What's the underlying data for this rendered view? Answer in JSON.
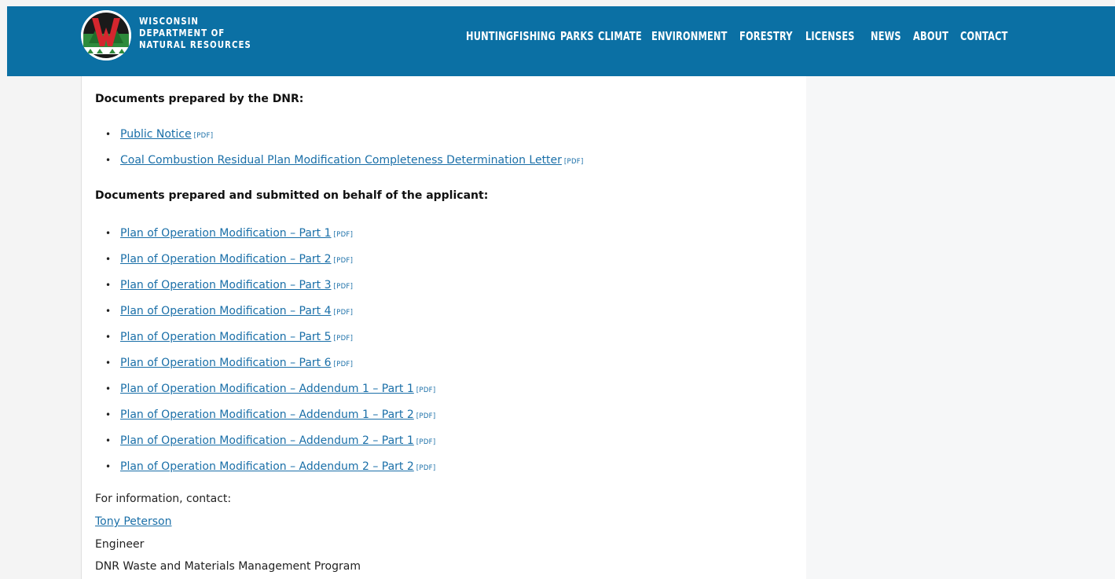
{
  "header": {
    "logo_lines": [
      "WISCONSIN",
      "DEPARTMENT OF",
      "NATURAL RESOURCES"
    ],
    "brand_color": "#0b70a4",
    "logo_icon": "dnr-w-logo-icon",
    "nav": [
      "HUNTING",
      "FISHING",
      "PARKS",
      "CLIMATE",
      "ENVIRONMENT",
      "FORESTRY",
      "LICENSES",
      "NEWS",
      "ABOUT",
      "CONTACT"
    ]
  },
  "main": {
    "dnr_heading": "Documents prepared by the DNR:",
    "dnr_docs": [
      {
        "label": "Public Notice",
        "tag": "[PDF]"
      },
      {
        "label": "Coal Combustion Residual Plan Modification Completeness Determination Letter",
        "tag": "[PDF]"
      }
    ],
    "applicant_heading": "Documents prepared and submitted on behalf of the applicant:",
    "applicant_docs": [
      {
        "label": "Plan of Operation Modification – Part 1",
        "tag": "[PDF]"
      },
      {
        "label": "Plan of Operation Modification – Part 2",
        "tag": "[PDF]"
      },
      {
        "label": "Plan of Operation Modification – Part 3",
        "tag": "[PDF]"
      },
      {
        "label": "Plan of Operation Modification – Part 4",
        "tag": "[PDF]"
      },
      {
        "label": "Plan of Operation Modification – Part 5",
        "tag": "[PDF]"
      },
      {
        "label": "Plan of Operation Modification – Part 6",
        "tag": "[PDF]"
      },
      {
        "label": "Plan of Operation Modification – Addendum 1 – Part 1",
        "tag": "[PDF]"
      },
      {
        "label": "Plan of Operation Modification – Addendum 1 – Part 2",
        "tag": "[PDF]"
      },
      {
        "label": "Plan of Operation Modification – Addendum 2 – Part 1",
        "tag": "[PDF]"
      },
      {
        "label": "Plan of Operation Modification – Addendum 2 – Part 2",
        "tag": "[PDF]"
      }
    ],
    "contact": {
      "intro": "For information, contact:",
      "name": "Tony Peterson",
      "title": "Engineer",
      "program": "DNR Waste and Materials Management Program"
    }
  }
}
